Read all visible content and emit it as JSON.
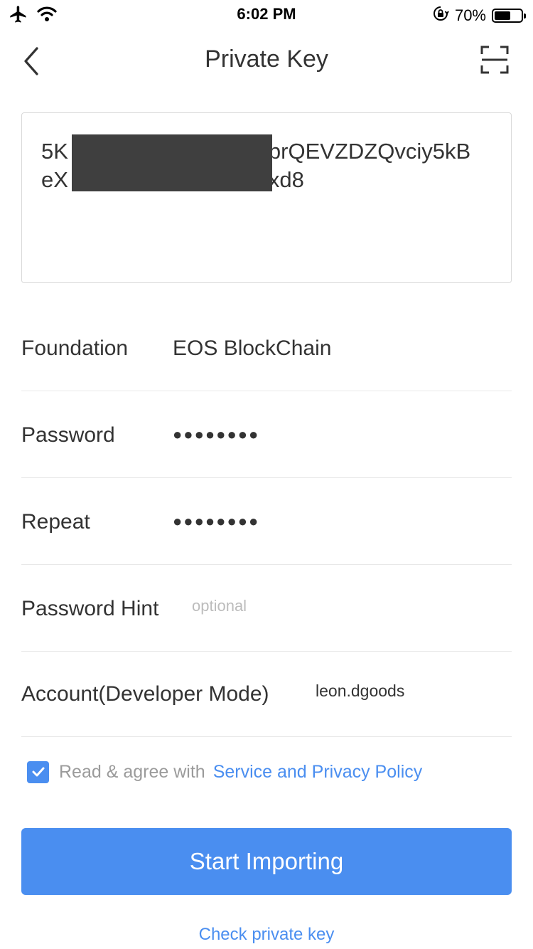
{
  "status_bar": {
    "time": "6:02 PM",
    "battery_percent": "70%",
    "battery_level": 0.7,
    "icons": [
      "airplane-icon",
      "wifi-icon",
      "orientation-lock-icon",
      "battery-icon"
    ]
  },
  "nav": {
    "title": "Private Key",
    "back_icon": "chevron-left-icon",
    "scan_icon": "scan-icon"
  },
  "private_key": {
    "line1_visible": "5K",
    "line1_tail": "prQEVZDZQvciy5kB",
    "line2_visible": "eX",
    "line2_tail": "xd8",
    "redacted": true
  },
  "form": {
    "foundation": {
      "label": "Foundation",
      "value": "EOS BlockChain"
    },
    "password": {
      "label": "Password",
      "masked": "●●●●●●●●"
    },
    "repeat": {
      "label": "Repeat",
      "masked": "●●●●●●●●"
    },
    "password_hint": {
      "label": "Password Hint",
      "placeholder": "optional",
      "value": ""
    },
    "account": {
      "label": "Account(Developer Mode)",
      "value": "leon.dgoods"
    }
  },
  "agreement": {
    "checked": true,
    "text": "Read & agree with",
    "link": "Service and Privacy Policy"
  },
  "actions": {
    "start_importing": "Start Importing",
    "check_private_key": "Check private key"
  },
  "colors": {
    "accent": "#4a8ef0",
    "text": "#333333",
    "muted": "#9b9b9b",
    "placeholder": "#bcbcbc",
    "divider": "#e8e8e8",
    "redaction": "#3f3f3f"
  }
}
